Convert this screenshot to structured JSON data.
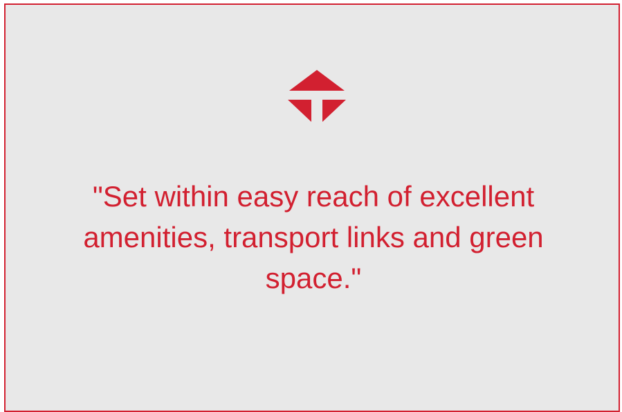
{
  "card": {
    "quote": "\"Set within easy reach of excellent amenities, transport links and green space.\"",
    "logo_icon": "red-triangle-arrow-logo-icon",
    "accent_color": "#d22030",
    "background_color": "#e8e8e8"
  }
}
